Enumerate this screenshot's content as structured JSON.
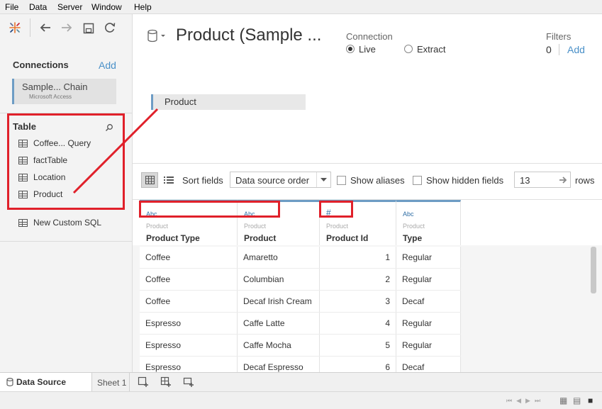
{
  "menu": [
    "File",
    "Data",
    "Server",
    "Window",
    "Help"
  ],
  "datasource_title": "Product (Sample ...",
  "connections": {
    "title": "Connections",
    "add_label": "Add",
    "items": [
      {
        "name": "Sample... Chain",
        "type": "Microsoft Access"
      }
    ]
  },
  "tables": {
    "title": "Table",
    "items": [
      "Coffee... Query",
      "factTable",
      "Location",
      "Product"
    ],
    "custom_sql": "New Custom SQL"
  },
  "connection_mode": {
    "label": "Connection",
    "options": [
      "Live",
      "Extract"
    ],
    "selected": "Live"
  },
  "filters": {
    "label": "Filters",
    "count": "0",
    "add_label": "Add"
  },
  "canvas_table": "Product",
  "grid_toolbar": {
    "sort_label": "Sort fields",
    "sort_value": "Data source order",
    "show_aliases": "Show aliases",
    "show_hidden": "Show hidden fields",
    "rows_value": "13",
    "rows_label": "rows"
  },
  "columns": [
    {
      "type": "Abc",
      "source": "Product",
      "name": "Product Type"
    },
    {
      "type": "Abc",
      "source": "Product",
      "name": "Product"
    },
    {
      "type": "#",
      "source": "Product",
      "name": "Product Id"
    },
    {
      "type": "Abc",
      "source": "Product",
      "name": "Type"
    }
  ],
  "rows": [
    [
      "Coffee",
      "Amaretto",
      "1",
      "Regular"
    ],
    [
      "Coffee",
      "Columbian",
      "2",
      "Regular"
    ],
    [
      "Coffee",
      "Decaf Irish Cream",
      "3",
      "Decaf"
    ],
    [
      "Espresso",
      "Caffe Latte",
      "4",
      "Regular"
    ],
    [
      "Espresso",
      "Caffe Mocha",
      "5",
      "Regular"
    ],
    [
      "Espresso",
      "Decaf Espresso",
      "6",
      "Decaf"
    ]
  ],
  "tabs": {
    "data_source": "Data Source",
    "sheet": "Sheet 1"
  },
  "colors": {
    "accent": "#4a90c8",
    "highlight": "#e0202a"
  }
}
